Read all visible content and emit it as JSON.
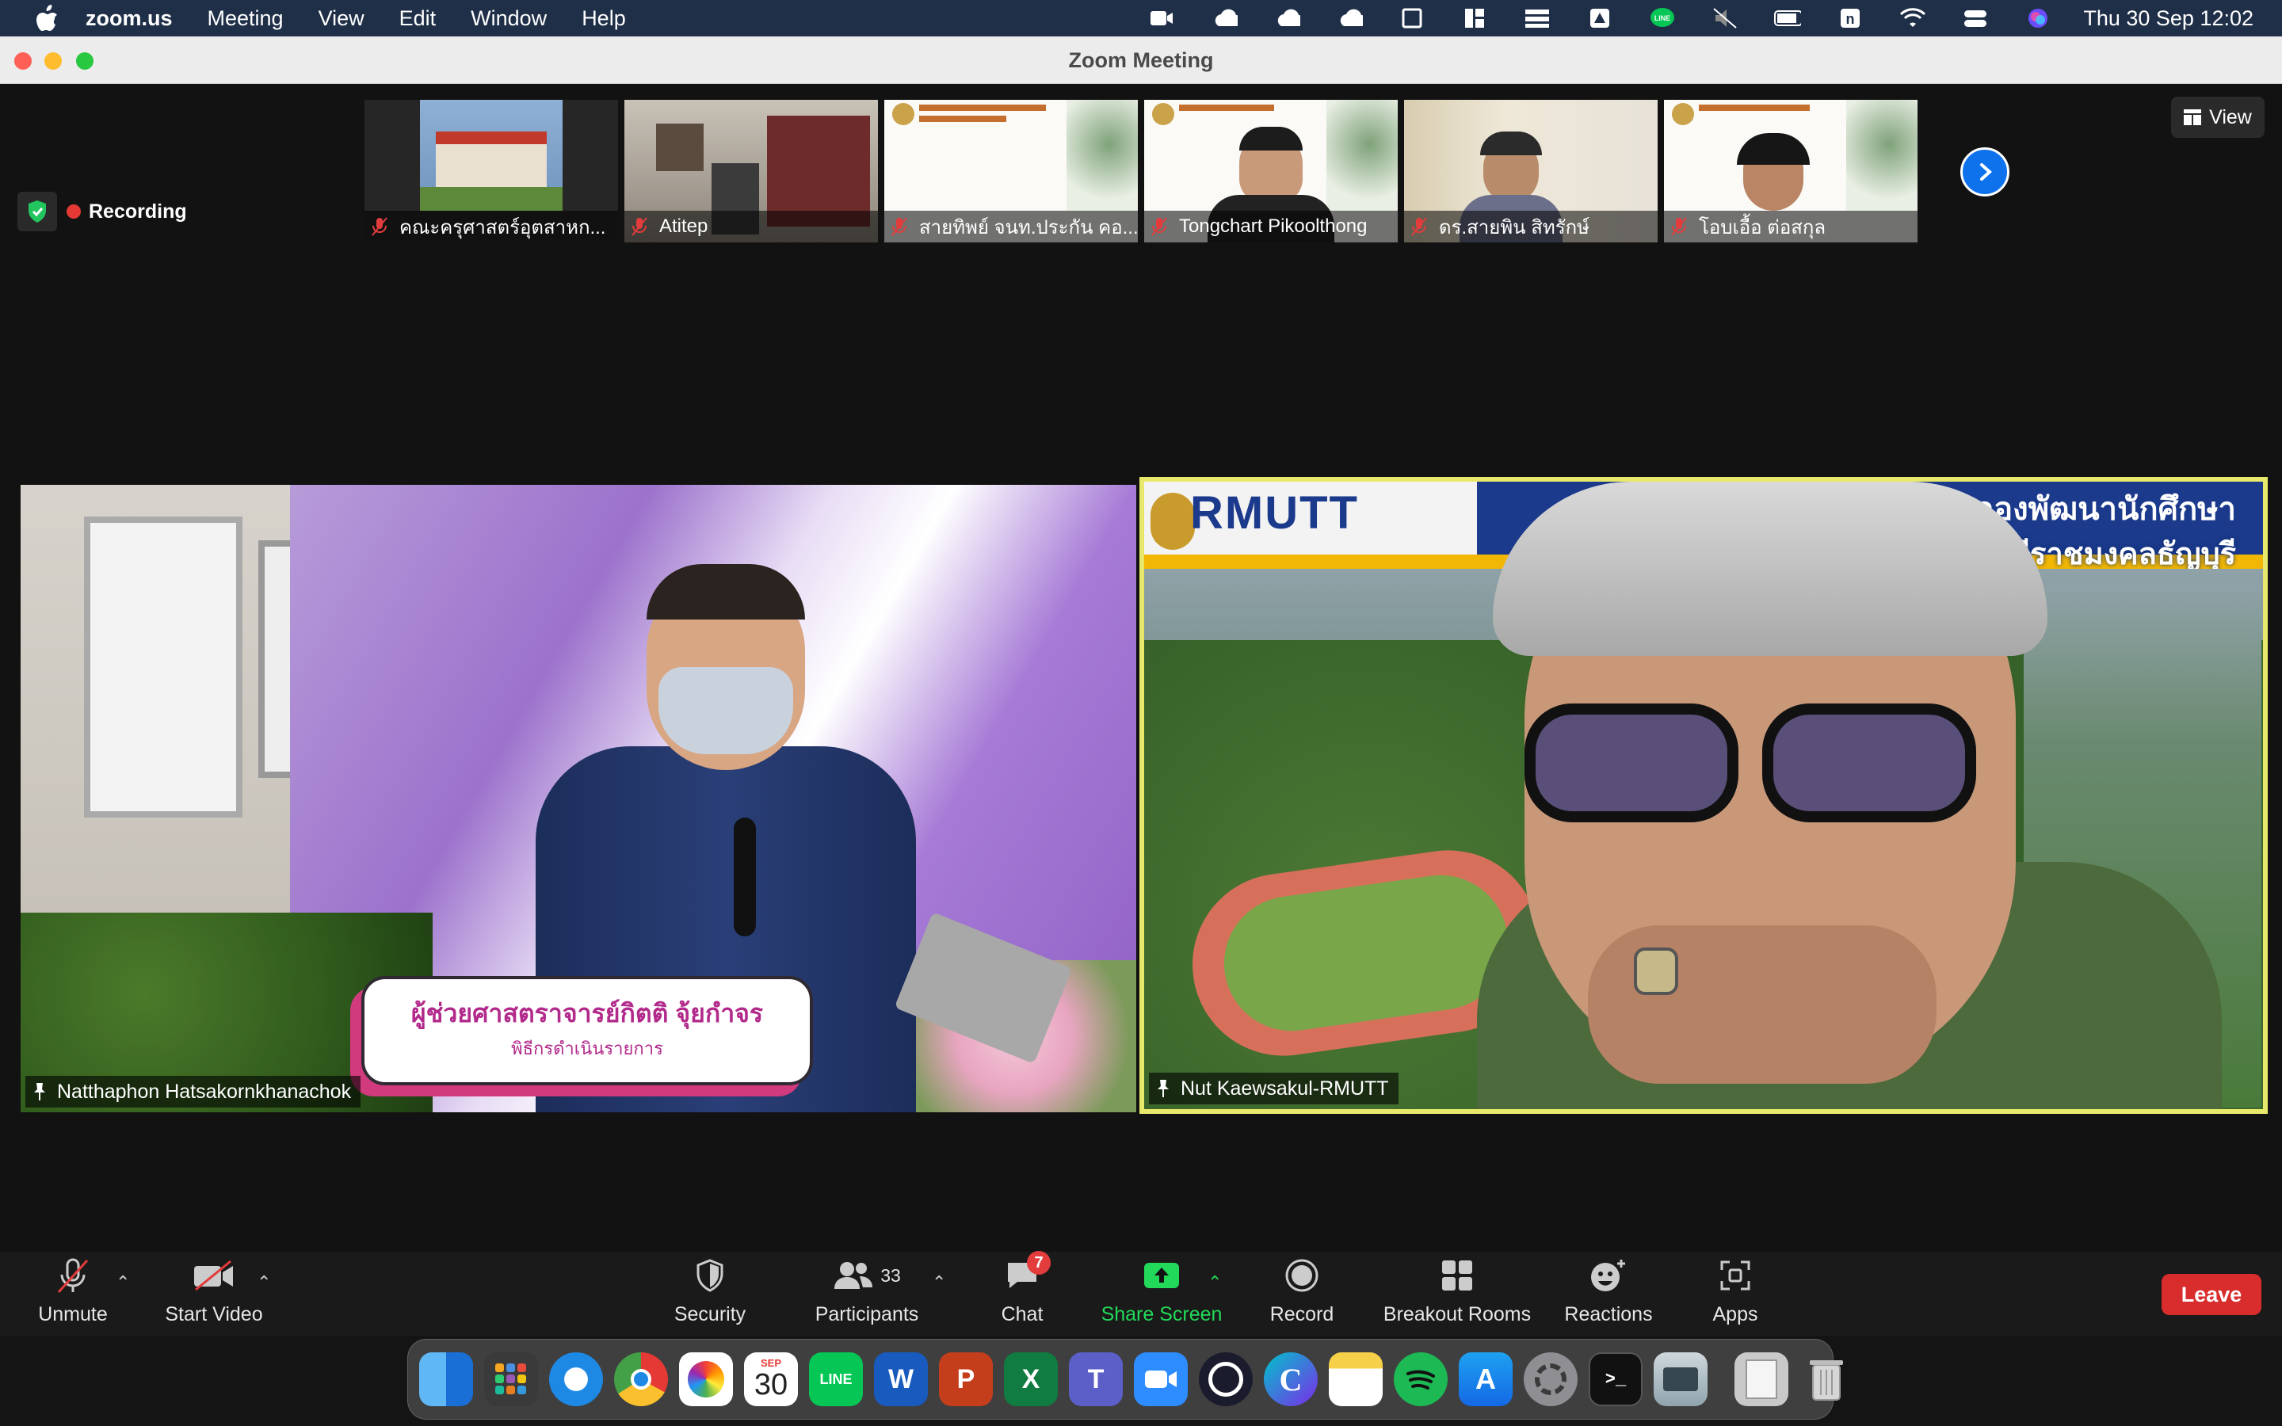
{
  "menubar": {
    "app": "zoom.us",
    "menus": [
      "Meeting",
      "View",
      "Edit",
      "Window",
      "Help"
    ],
    "clock": "Thu 30 Sep  12:02"
  },
  "window": {
    "title": "Zoom Meeting"
  },
  "gallery": {
    "thumbnails": [
      {
        "name": "คณะครุศาสตร์อุตสาหก..."
      },
      {
        "name": "Atitep"
      },
      {
        "name": "สายทิพย์ จนท.ประกัน คอ..."
      },
      {
        "name": "Tongchart Pikoolthong"
      },
      {
        "name": "ดร.สายพิน  สิทรักษ์"
      },
      {
        "name": "โอบเอื้อ ต่อสกุล"
      }
    ],
    "view_label": "View"
  },
  "status": {
    "recording_label": "Recording"
  },
  "tiles": {
    "left": {
      "name": "Natthaphon Hatsakornkhanachok",
      "overlay_title": "ผู้ช่วยศาสตราจารย์กิตติ จุ้ยกำจร",
      "overlay_subtitle": "พิธีกรดำเนินรายการ"
    },
    "right": {
      "name": "Nut Kaewsakul-RMUTT",
      "logo_text": "RMUTT",
      "banner_line1": "กองพัฒนานักศึกษา",
      "banner_line2": "โนโลยีราชมงคลธัญบุรี"
    }
  },
  "toolbar": {
    "unmute": "Unmute",
    "start_video": "Start Video",
    "security": "Security",
    "participants": "Participants",
    "participants_count": "33",
    "chat": "Chat",
    "chat_badge": "7",
    "share_screen": "Share Screen",
    "record": "Record",
    "breakout_rooms": "Breakout Rooms",
    "reactions": "Reactions",
    "apps": "Apps",
    "leave": "Leave"
  },
  "dock": {
    "calendar_month": "SEP",
    "calendar_day": "30",
    "line_label": "LINE"
  },
  "colors": {
    "accent_blue": "#0e72ed",
    "share_green": "#23d959",
    "leave_red": "#d92c2c",
    "active_speaker": "#e8e86a"
  }
}
